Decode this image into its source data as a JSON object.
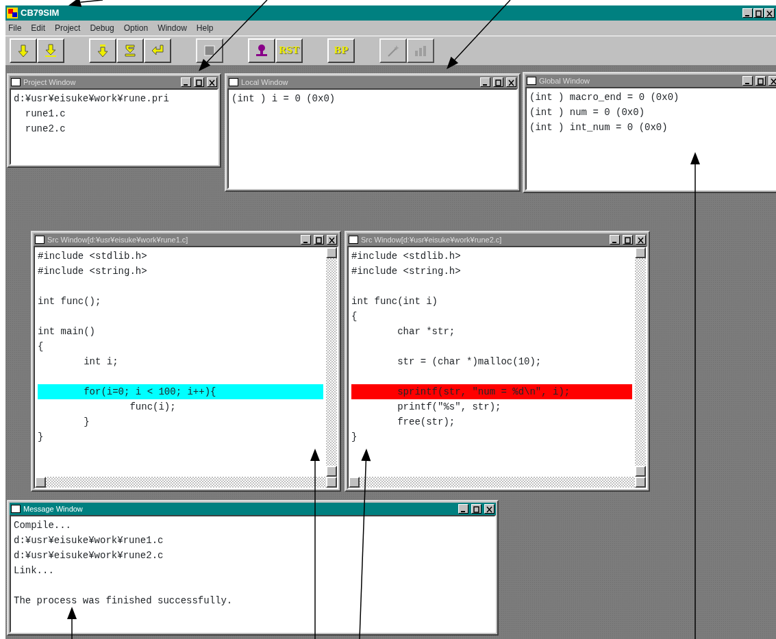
{
  "window": {
    "title": "CB79SIM"
  },
  "menu": [
    "File",
    "Edit",
    "Project",
    "Debug",
    "Option",
    "Window",
    "Help"
  ],
  "toolbar": [
    {
      "kind": "down-arrow",
      "disabled": false
    },
    {
      "kind": "down-arrow-bar",
      "disabled": false
    },
    {
      "kind": "step-down",
      "disabled": false
    },
    {
      "kind": "step-over",
      "disabled": false
    },
    {
      "kind": "return",
      "disabled": false
    },
    {
      "kind": "stop",
      "disabled": true
    },
    {
      "kind": "stamp",
      "disabled": false
    },
    {
      "kind": "text",
      "label": "RST",
      "disabled": false
    },
    {
      "kind": "text",
      "label": "BP",
      "disabled": false
    },
    {
      "kind": "wand",
      "disabled": true
    },
    {
      "kind": "chart",
      "disabled": true
    }
  ],
  "windows": [
    {
      "title": "Project Window",
      "active": false,
      "lines": [
        {
          "text": "d:¥usr¥eisuke¥work¥rune.pri"
        },
        {
          "text": "  rune1.c"
        },
        {
          "text": "  rune2.c"
        }
      ]
    },
    {
      "title": "Local Window",
      "active": false,
      "lines": [
        {
          "text": "(int ) i = 0 (0x0)"
        }
      ]
    },
    {
      "title": "Global Window",
      "active": false,
      "lines": [
        {
          "text": "(int ) macro_end = 0 (0x0)"
        },
        {
          "text": "(int ) num = 0 (0x0)"
        },
        {
          "text": "(int ) int_num = 0 (0x0)"
        }
      ]
    },
    {
      "title": "Src Window[d:¥usr¥eisuke¥work¥rune1.c]",
      "active": false,
      "scrollbars": true,
      "lines": [
        {
          "text": "#include <stdlib.h>",
          "blank_before": false
        },
        {
          "text": "#include <string.h>",
          "blank_before": false
        },
        {
          "text": "int func();",
          "blank_before": true
        },
        {
          "text": "int main()",
          "blank_before": true
        },
        {
          "text": "{",
          "blank_before": false
        },
        {
          "text": "        int i;",
          "blank_before": false
        },
        {
          "text": "        for(i=0; i < 100; i++){",
          "blank_before": true,
          "color": "#00ffff"
        },
        {
          "text": "                func(i);",
          "blank_before": false
        },
        {
          "text": "        }",
          "blank_before": false
        },
        {
          "text": "}",
          "blank_before": false
        }
      ]
    },
    {
      "title": "Src Window[d:¥usr¥eisuke¥work¥rune2.c]",
      "active": false,
      "scrollbars": true,
      "lines": [
        {
          "text": "#include <stdlib.h>",
          "blank_before": false
        },
        {
          "text": "#include <string.h>",
          "blank_before": false
        },
        {
          "text": "int func(int i)",
          "blank_before": true
        },
        {
          "text": "{",
          "blank_before": false
        },
        {
          "text": "        char *str;",
          "blank_before": false
        },
        {
          "text": "        str = (char *)malloc(10);",
          "blank_before": true
        },
        {
          "text": "        sprintf(str, \"num = %d\\n\", i);",
          "blank_before": true,
          "color": "#ff0000"
        },
        {
          "text": "        printf(\"%s\", str);",
          "blank_before": false
        },
        {
          "text": "        free(str);",
          "blank_before": false
        },
        {
          "text": "}",
          "blank_before": false
        }
      ]
    },
    {
      "title": "Message Window",
      "active": true,
      "lines": [
        {
          "text": "Compile...",
          "blank_before": false
        },
        {
          "text": "d:¥usr¥eisuke¥work¥rune1.c",
          "blank_before": false
        },
        {
          "text": "d:¥usr¥eisuke¥work¥rune2.c",
          "blank_before": false
        },
        {
          "text": "Link...",
          "blank_before": false
        },
        {
          "text": "The process was finished successfully.",
          "blank_before": true
        }
      ]
    }
  ]
}
